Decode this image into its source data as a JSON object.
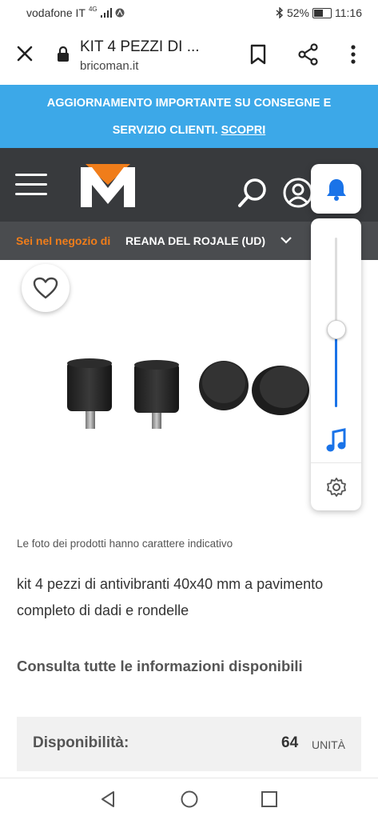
{
  "status_bar": {
    "carrier": "vodafone IT",
    "network": "4G",
    "battery": "52%",
    "time": "11:16"
  },
  "browser": {
    "page_title": "KIT 4 PEZZI DI ...",
    "domain": "bricoman.it"
  },
  "banner": {
    "line1": "AGGIORNAMENTO IMPORTANTE SU CONSEGNE E",
    "line2": "SERVIZIO CLIENTI.",
    "link": "SCOPRI"
  },
  "store": {
    "label": "Sei nel negozio di",
    "name": "REANA DEL ROJALE (UD)"
  },
  "product": {
    "caption": "Le foto dei prodotti hanno carattere indicativo",
    "description": "kit 4 pezzi di antivibranti 40x40 mm a pavimento completo di dadi e rondelle",
    "info_link": "Consulta tutte le informazioni disponibili",
    "availability_label": "Disponibilità:",
    "availability_value": "64",
    "availability_unit": "UNITÀ"
  },
  "volume": {
    "level": 0.46
  },
  "colors": {
    "banner": "#3ca8e8",
    "navbar": "#383a3d",
    "store_label": "#f07d1a",
    "accent": "#1a73e8"
  }
}
